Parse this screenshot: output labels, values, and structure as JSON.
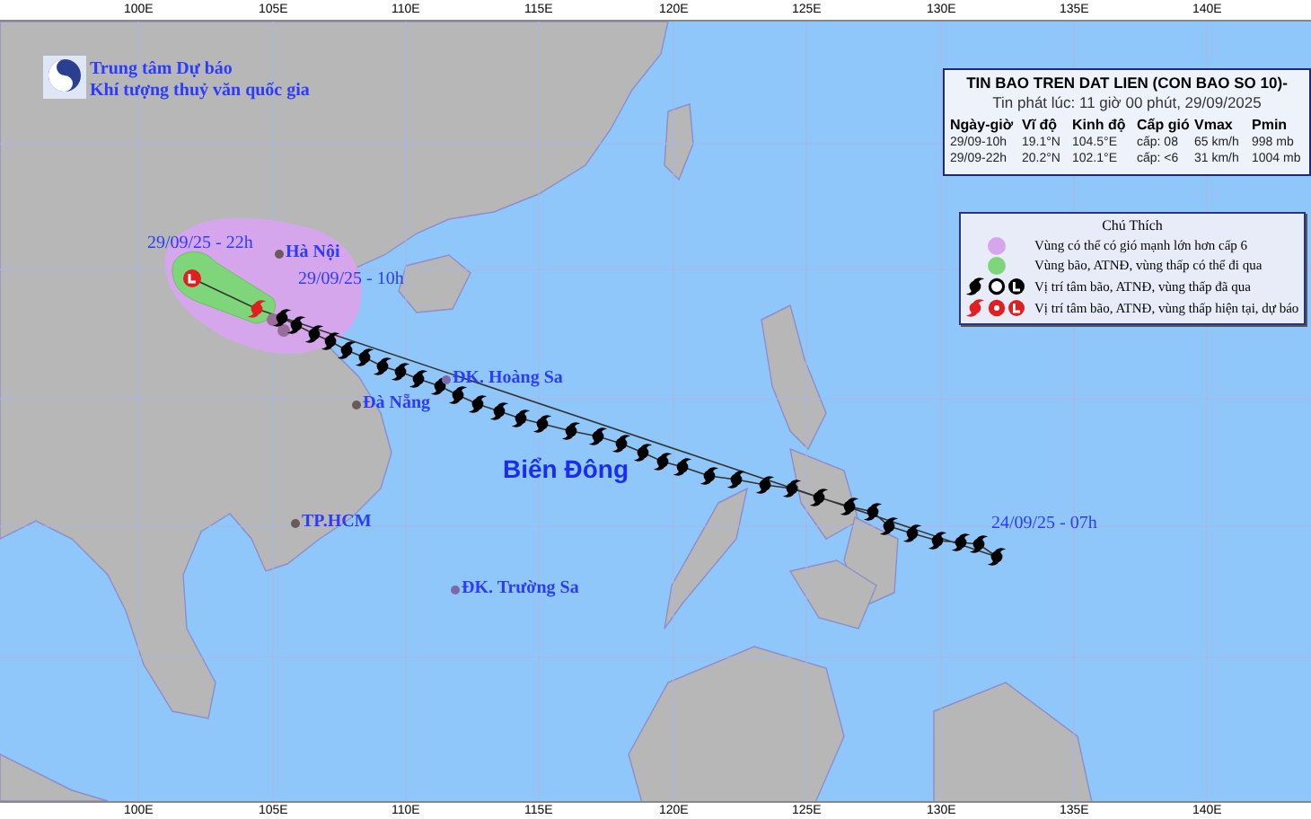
{
  "axis_top": [
    "100E",
    "105E",
    "110E",
    "115E",
    "120E",
    "125E",
    "130E",
    "135E",
    "140E"
  ],
  "axis_bottom": [
    "100E",
    "105E",
    "110E",
    "115E",
    "120E",
    "125E",
    "130E",
    "135E",
    "140E"
  ],
  "header": {
    "line_1": "Trung tâm Dự báo",
    "line_2": "Khí tượng thuỷ văn quốc gia"
  },
  "bulletin": {
    "title": "TIN BAO TREN DAT LIEN (CON BAO SO 10)-",
    "issued": "Tin phát lúc: 11 giờ 00 phút, 29/09/2025",
    "columns": [
      "Ngày-giờ",
      "Vĩ độ",
      "Kinh độ",
      "Cấp gió",
      "Vmax",
      "Pmin"
    ],
    "rows": [
      [
        "29/09-10h",
        "19.1°N",
        "104.5°E",
        "cấp: 08",
        "65 km/h",
        "998 mb"
      ],
      [
        "29/09-22h",
        "20.2°N",
        "102.1°E",
        "cấp: <6",
        "31 km/h",
        "1004 mb"
      ]
    ]
  },
  "legend": {
    "title": "Chú Thích",
    "items": [
      {
        "kind": "zone",
        "color": "#d6a6ec",
        "text": "Vùng có thể có gió mạnh lớn hơn cấp 6"
      },
      {
        "kind": "zone",
        "color": "#7fd67a",
        "text": "Vùng bão, ATNĐ, vùng thấp có thể đi qua"
      },
      {
        "kind": "past",
        "text": "Vị trí tâm bão, ATNĐ, vùng thấp đã qua"
      },
      {
        "kind": "current",
        "text": "Vị trí tâm bão, ATNĐ, vùng thấp hiện tại, dự báo"
      }
    ]
  },
  "places": [
    {
      "kind": "city",
      "label": "Hà Nội"
    },
    {
      "kind": "city",
      "label": "Đà Nẵng"
    },
    {
      "kind": "island",
      "label": "ĐK. Hoàng Sa"
    },
    {
      "kind": "city",
      "label": "TP.HCM"
    },
    {
      "kind": "island",
      "label": "ĐK. Trường Sa"
    }
  ],
  "track_labels": [
    "29/09/25 - 22h",
    "29/09/25 - 10h",
    "24/09/25 - 07h"
  ],
  "sea_label": "Biển Đông"
}
